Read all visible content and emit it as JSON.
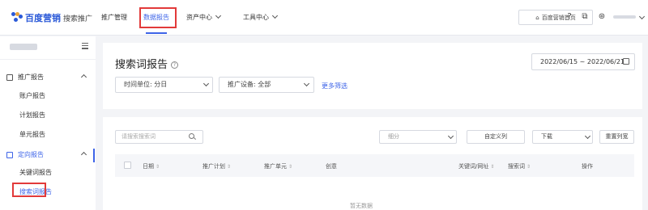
{
  "brand": {
    "name": "百度营销",
    "product": "搜索推广"
  },
  "nav": [
    {
      "label": "推广管理"
    },
    {
      "label": "数据报告"
    },
    {
      "label": "资产中心"
    },
    {
      "label": "工具中心"
    }
  ],
  "header": {
    "home_label": "百度营销首页"
  },
  "sidebar": {
    "groups": [
      {
        "label": "推广报告",
        "items": [
          "账户报告",
          "计划报告",
          "单元报告"
        ]
      },
      {
        "label": "定向报告",
        "items": [
          "关键词报告",
          "搜索词报告"
        ]
      }
    ]
  },
  "report": {
    "title": "搜索词报告",
    "date_range": "2022/06/15 ~ 2022/06/21",
    "time_unit": "时间单位: 分日",
    "device": "推广设备: 全部",
    "more_filters": "更多筛选"
  },
  "table": {
    "search_placeholder": "请搜索搜索词",
    "segment_label": "细分",
    "custom_columns": "自定义列",
    "download": "下载",
    "reset_columns": "重置列宽",
    "columns": [
      "日期",
      "推广计划",
      "推广单元",
      "创意",
      "关键词/网址",
      "搜索词",
      "操作"
    ],
    "empty_text": "暂无数据"
  },
  "colors": {
    "accent": "#3e64e8",
    "highlight": "#e23a3a"
  }
}
